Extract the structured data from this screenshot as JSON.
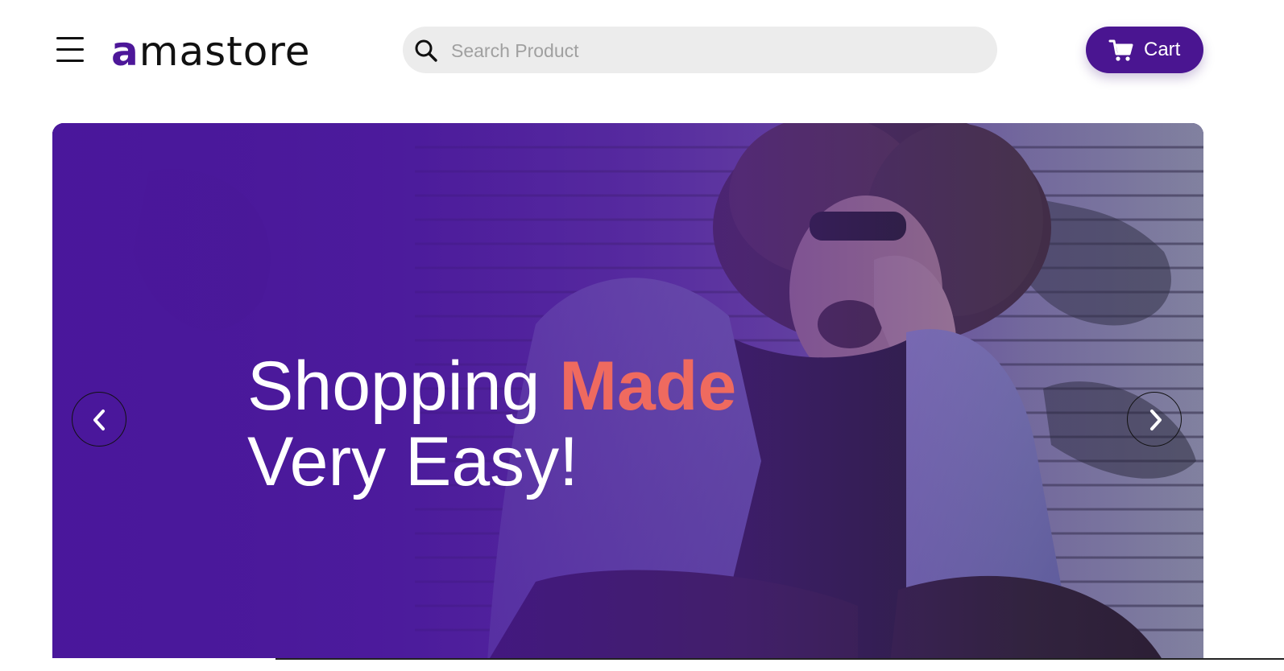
{
  "header": {
    "logo_accent": "a",
    "logo_rest": "mastore",
    "search_placeholder": "Search Product",
    "cart_label": "Cart"
  },
  "hero": {
    "headline_part1": "Shopping ",
    "headline_highlight": "Made",
    "headline_line2": "Very Easy!"
  },
  "colors": {
    "brand": "#4a1591",
    "accent": "#ef6a5f",
    "search_bg": "#ececec"
  },
  "icons": {
    "menu": "hamburger-menu-icon",
    "search": "search-icon",
    "cart": "shopping-cart-icon",
    "prev": "chevron-left-icon",
    "next": "chevron-right-icon"
  }
}
